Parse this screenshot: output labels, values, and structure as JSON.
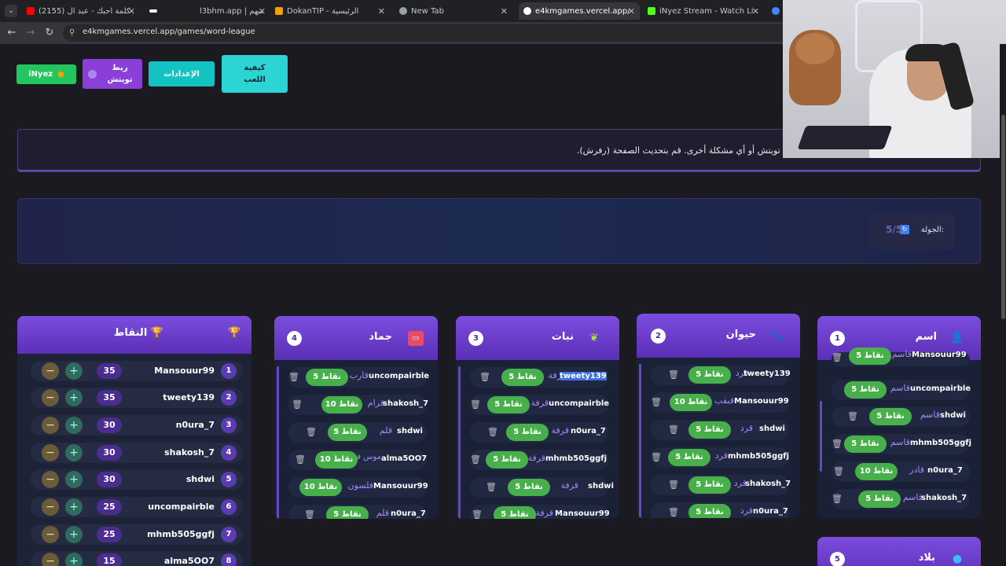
{
  "browser": {
    "tabs": [
      {
        "title": "(2155) تنتظر كلمة احبك - عبد ال...",
        "favicon_color": "#ff0000",
        "active": false
      },
      {
        "title": "",
        "favicon_color": "#ffffff",
        "active": false
      },
      {
        "title": "l3bhm.app | لعبهم",
        "favicon_color": "#2a2a2a",
        "active": false
      },
      {
        "title": "DokanTIP - الرئيسية",
        "favicon_color": "#f59e0b",
        "active": false
      },
      {
        "title": "New Tab",
        "favicon_color": "#9aa0a6",
        "active": false
      },
      {
        "title": "e4kmgames.vercel.app/games/...",
        "favicon_color": "#ffffff",
        "active": true
      },
      {
        "title": "iNyez Stream - Watch Live on K...",
        "favicon_color": "#53fc18",
        "active": false
      },
      {
        "title": "",
        "favicon_color": "#4285f4",
        "active": false
      }
    ],
    "url": "e4kmgames.vercel.app/games/word-league"
  },
  "header_buttons": {
    "inyez": "iNyez",
    "twitch_connect": "ربط تويتش",
    "settings": "الإعدادات",
    "how_to_play": "كيفية اللعب"
  },
  "notice": {
    "text": "ة تويتش أو أي مشكلة أخرى. قم بتحديث الصفحة (رفرش)."
  },
  "round": {
    "label": "الجولة:",
    "value": "5/5"
  },
  "scoreboard": {
    "title": "النقاط",
    "rows": [
      {
        "rank": "1",
        "name": "Mansouur99",
        "score": "35"
      },
      {
        "rank": "2",
        "name": "tweety139",
        "score": "35"
      },
      {
        "rank": "3",
        "name": "n0ura_7",
        "score": "30"
      },
      {
        "rank": "4",
        "name": "shakosh_7",
        "score": "30"
      },
      {
        "rank": "5",
        "name": "shdwi",
        "score": "30"
      },
      {
        "rank": "6",
        "name": "uncompairble",
        "score": "25"
      },
      {
        "rank": "7",
        "name": "mhmb505ggfj",
        "score": "25"
      },
      {
        "rank": "8",
        "name": "alma5OO7",
        "score": "15"
      }
    ]
  },
  "categories": [
    {
      "title": "جماد",
      "number": "4",
      "icon": "chest-icon",
      "rows": [
        {
          "user": "uncompairble",
          "answer": "قارب",
          "points": "5 نقاط"
        },
        {
          "user": "shakosh_7",
          "answer": "قرام",
          "points": "10 نقاط"
        },
        {
          "user": "shdwi",
          "answer": "قلم",
          "points": "5 نقاط"
        },
        {
          "user": "alma5OO7",
          "answer": "موس فنه",
          "points": "10 نقاط"
        },
        {
          "user": "Mansouur99",
          "answer": "فلسون",
          "points": "10 نقاط"
        },
        {
          "user": "n0ura_7",
          "answer": "قلم",
          "points": "5 نقاط"
        }
      ]
    },
    {
      "title": "نبات",
      "number": "3",
      "icon": "leaf-icon",
      "rows": [
        {
          "user": "tweety139",
          "answer": "قرفة",
          "points": "5 نقاط"
        },
        {
          "user": "uncompairble",
          "answer": "قرفة",
          "points": "5 نقاط"
        },
        {
          "user": "n0ura_7",
          "answer": "قرفة",
          "points": "5 نقاط"
        },
        {
          "user": "mhmb505ggfj",
          "answer": "قرفة",
          "points": "5 نقاط"
        },
        {
          "user": "shdwi",
          "answer": "قرفة",
          "points": "5 نقاط"
        },
        {
          "user": "Mansouur99",
          "answer": "قرفة",
          "points": "5 نقاط"
        }
      ]
    },
    {
      "title": "حيوان",
      "number": "2",
      "icon": "paw-icon",
      "rows": [
        {
          "user": "tweety139",
          "answer": "قرد",
          "points": "5 نقاط"
        },
        {
          "user": "Mansouur99",
          "answer": "قبقب",
          "points": "10 نقاط"
        },
        {
          "user": "shdwi",
          "answer": "قرد",
          "points": "5 نقاط"
        },
        {
          "user": "mhmb505ggfj",
          "answer": "قرد",
          "points": "5 نقاط"
        },
        {
          "user": "shakosh_7",
          "answer": "قرد",
          "points": "5 نقاط"
        },
        {
          "user": "n0ura_7",
          "answer": "قرد",
          "points": "5 نقاط"
        }
      ]
    },
    {
      "title": "اسم",
      "number": "1",
      "icon": "person-icon",
      "rows": [
        {
          "user": "Mansouur99",
          "answer": "قاسم",
          "points": "5 نقاط"
        },
        {
          "user": "uncompairble",
          "answer": "قاسم",
          "points": "5 نقاط"
        },
        {
          "user": "shdwi",
          "answer": "قاسم",
          "points": "5 نقاط"
        },
        {
          "user": "mhmb505ggfj",
          "answer": "قاسم",
          "points": "5 نقاط"
        },
        {
          "user": "n0ura_7",
          "answer": "قادر",
          "points": "10 نقاط"
        },
        {
          "user": "shakosh_7",
          "answer": "قاسم",
          "points": "5 نقاط"
        }
      ]
    },
    {
      "title": "بلاد",
      "number": "5",
      "icon": "globe-icon",
      "rows": []
    }
  ]
}
